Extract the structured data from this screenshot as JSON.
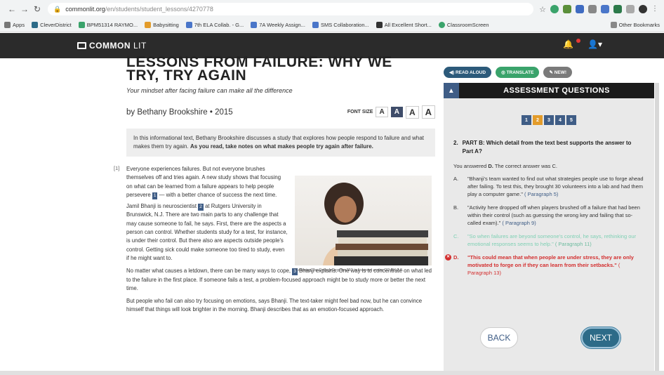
{
  "browser": {
    "url_host": "commonlit.org",
    "url_path": "/en/students/student_lessons/4270778",
    "bookmarks": [
      "Apps",
      "CleverDistrict",
      "BPM51314 RAYMO...",
      "Babysitting",
      "7th ELA Collab. - G...",
      "7A Weekly Assign...",
      "SMS Collaboration...",
      "All Excellent Short...",
      "ClassroomScreen"
    ],
    "other_bookmarks": "Other Bookmarks"
  },
  "app": {
    "brand_common": "COMMON",
    "brand_lit": "LIT"
  },
  "article": {
    "title_line1": "LESSONS FROM FAILURE: WHY WE",
    "title_line2": "TRY, TRY AGAIN",
    "subtitle": "Your mindset after facing failure can make all the difference",
    "author": "by Bethany Brookshire",
    "year": "2015",
    "font_size_label": "FONT SIZE",
    "font_a": "A",
    "intro_plain": "In this informational text, Bethany Brookshire discusses a study that explores how people respond to failure and what makes them try again.",
    "intro_bold": "As you read, take notes on what makes people try again after failure.",
    "para_marker": "[1]",
    "p1a": "Everyone experiences failures. But not everyone brushes themselves off and tries again. A new study shows that focusing on what can be learned from a failure appears to help people persevere",
    "p1_note": "1",
    "p1b": "— with a better chance of success the next time.",
    "p2a": "Jamil Bhanji is neuroscientist",
    "p2_note": "2",
    "p2b": "at Rutgers University in Brunswick, N.J. There are two main parts to any challenge that may cause someone to fail, he says. First, there are the aspects a person can control. Whether students study for a test, for instance, is under their control. But there also are aspects outside people's control. Getting sick could make someone too tired to study, even if he might want to.",
    "p3a": "No matter what causes a letdown, there can be many ways to cope,",
    "p3_note": "3",
    "p3b": "Bhanji explains. One way is to concentrate on what led to the failure in the first place. If someone fails a test, a problem-focused approach might be to study more or better the next time.",
    "p4": "But people who fail can also try focusing on emotions, says Bhanji. The text-taker might feel bad now, but he can convince himself that things will look brighter in the morning. Bhanji describes that as an emotion-focused approach.",
    "caption": "\"Learning\" by CollegeDegrees360 is licensed under CC BY 2.0."
  },
  "tools": {
    "read_aloud": "READ ALOUD",
    "translate": "TRANSLATE",
    "note": "NEW!"
  },
  "panel": {
    "title": "ASSESSMENT QUESTIONS",
    "steps": [
      "1",
      "2",
      "3",
      "4",
      "5"
    ],
    "question_number": "2.",
    "question": "PART B: Which detail from the text best supports the answer to Part A?",
    "answered_prefix": "You answered",
    "answered_choice": "D.",
    "correct_text": "The correct answer was C.",
    "choices": [
      {
        "letter": "A.",
        "text": "\"Bhanji's team wanted to find out what strategies people use to forge ahead after failing. To test this, they brought 30 volunteers into a lab and had them play a computer game.\"",
        "para": "( Paragraph 5)"
      },
      {
        "letter": "B.",
        "text": "\"Activity here dropped off when players brushed off a failure that had been within their control (such as guessing the wrong key and failing that so-called exam).\"",
        "para": "( Paragraph 9)"
      },
      {
        "letter": "C.",
        "text": "\"So when failures are beyond someone's control, he says, rethinking our emotional responses seems to help.\"",
        "para": "( Paragraph 11)"
      },
      {
        "letter": "D.",
        "text": "\"This could mean that when people are under stress, they are only motivated to forge on if they can learn from their setbacks.\"",
        "para": "( Paragraph 13)"
      }
    ],
    "back": "BACK",
    "next": "NEXT"
  },
  "colors": {
    "header": "#2b2b2b",
    "accent": "#3f5d86",
    "current_step": "#e39c2b",
    "wrong": "#d32f2f",
    "correct": "#7fd0b4",
    "next_button": "#2d6b88"
  }
}
